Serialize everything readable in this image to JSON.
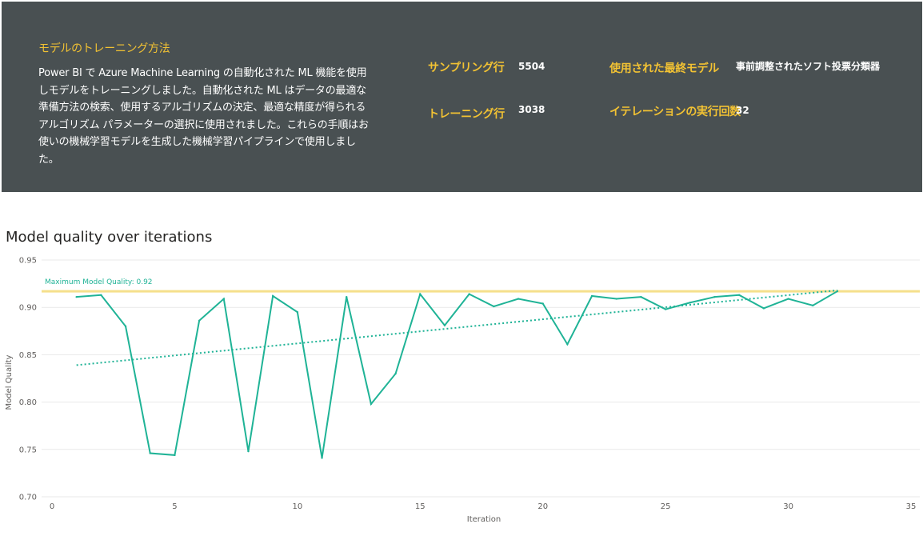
{
  "panel": {
    "title": "モデルのトレーニング方法",
    "description": "Power BI で Azure Machine Learning の自動化された ML 機能を使用しモデルをトレーニングしました。自動化された ML はデータの最適な準備方法の検索、使用するアルゴリズムの決定、最適な精度が得られるアルゴリズム パラメーターの選択に使用されました。これらの手順はお使いの機械学習モデルを生成した機械学習パイプラインで使用しました。",
    "stats": {
      "sampling_rows_label": "サンプリング行",
      "sampling_rows_value": "5504",
      "training_rows_label": "トレーニング行",
      "training_rows_value": "3038",
      "final_model_label": "使用された最終モデル",
      "final_model_value": "事前調整されたソフト投票分類器",
      "iterations_label": "イテレーションの実行回数",
      "iterations_value": "32"
    },
    "colors": {
      "background": "#495052",
      "accent": "#f2c233",
      "text": "#ffffff"
    }
  },
  "chart_data": {
    "type": "line",
    "title": "Model quality over iterations",
    "xlabel": "Iteration",
    "ylabel": "Model Quality",
    "xlim": [
      0,
      35
    ],
    "ylim": [
      0.7,
      0.95
    ],
    "x_ticks": [
      0,
      5,
      10,
      15,
      20,
      25,
      30,
      35
    ],
    "y_ticks": [
      0.7,
      0.75,
      0.8,
      0.85,
      0.9,
      0.95
    ],
    "y_tick_labels": [
      "0.70",
      "0.75",
      "0.80",
      "0.85",
      "0.90",
      "0.95"
    ],
    "grid": true,
    "series": [
      {
        "color": "#1fb396",
        "x": [
          1,
          2,
          3,
          4,
          5,
          6,
          7,
          8,
          9,
          10,
          11,
          12,
          13,
          14,
          15,
          16,
          17,
          18,
          19,
          20,
          21,
          22,
          23,
          24,
          25,
          26,
          27,
          28,
          29,
          30,
          31,
          32
        ],
        "values": [
          0.911,
          0.913,
          0.88,
          0.746,
          0.744,
          0.886,
          0.909,
          0.748,
          0.912,
          0.895,
          0.741,
          0.911,
          0.798,
          0.83,
          0.914,
          0.881,
          0.914,
          0.901,
          0.909,
          0.904,
          0.861,
          0.912,
          0.909,
          0.911,
          0.898,
          0.905,
          0.911,
          0.913,
          0.899,
          0.909,
          0.902,
          0.917
        ]
      }
    ],
    "trendline": {
      "color": "#1fb396",
      "x": [
        1,
        32
      ],
      "values": [
        0.839,
        0.918
      ],
      "style": "dotted"
    },
    "reference_line": {
      "label": "Maximum Model Quality: 0.92",
      "value": 0.917,
      "color": "#f5e08c"
    }
  }
}
